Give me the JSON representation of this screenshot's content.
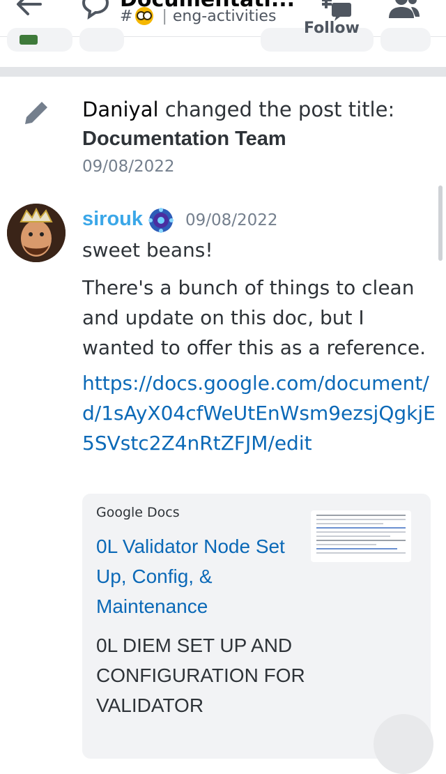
{
  "header": {
    "title": "Documentati...",
    "channel_prefix": "#",
    "channel_name": "eng-activities"
  },
  "toolbar": {
    "follow_label": "Follow"
  },
  "system_message": {
    "author": "Daniyal",
    "action": "changed the post title:",
    "title": "Documentation Team",
    "date": "09/08/2022"
  },
  "message": {
    "author": "sirouk",
    "date": "09/08/2022",
    "line1": "sweet beans!",
    "paragraph": "There's a bunch of things to clean and update on this doc, but I wanted to offer this as a reference.",
    "link": "https://docs.google.com/document/d/1sAyX04cfWeUtEnWsm9ezsjQgkjE5SVstc2Z4nRtZFJM/edit"
  },
  "embed": {
    "provider": "Google Docs",
    "title": "0L Validator Node Set Up, Config, & Maintenance",
    "description": "0L DIEM SET UP AND CONFIGURATION FOR VALIDATOR"
  },
  "colors": {
    "author": "#3ba7e8",
    "link": "#0b69b7",
    "muted": "#747f8d"
  }
}
